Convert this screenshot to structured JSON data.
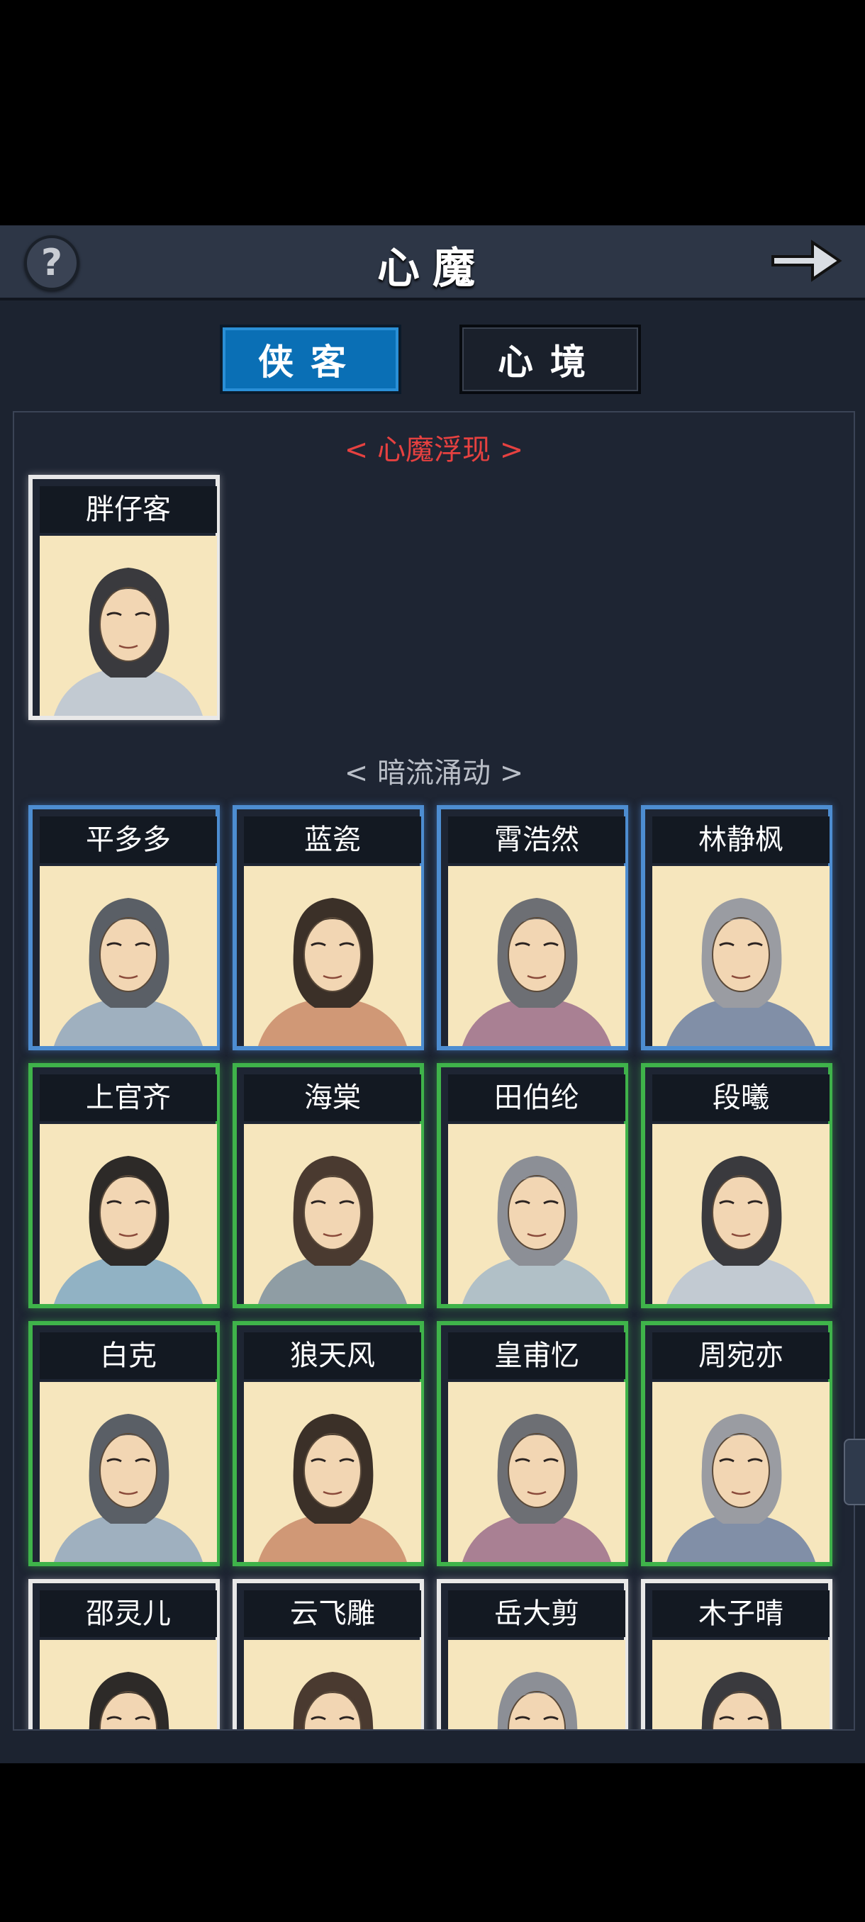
{
  "header": {
    "title": "心魔",
    "help_icon": "question-icon",
    "next_icon": "arrow-right-icon"
  },
  "tabs": [
    {
      "label": "侠客",
      "active": true
    },
    {
      "label": "心境",
      "active": false
    }
  ],
  "sections": [
    {
      "label": "< 心魔浮现 >",
      "color": "#e64140"
    },
    {
      "label": "< 暗流涌动 >",
      "color": "#b9bec7"
    }
  ],
  "featured": [
    {
      "name": "胖仔客",
      "rarity": "white"
    }
  ],
  "characters": [
    {
      "name": "平多多",
      "rarity": "blue"
    },
    {
      "name": "蓝瓷",
      "rarity": "blue"
    },
    {
      "name": "霄浩然",
      "rarity": "blue"
    },
    {
      "name": "林静枫",
      "rarity": "blue"
    },
    {
      "name": "上官齐",
      "rarity": "green"
    },
    {
      "name": "海棠",
      "rarity": "green"
    },
    {
      "name": "田伯纶",
      "rarity": "green"
    },
    {
      "name": "段曦",
      "rarity": "green"
    },
    {
      "name": "白克",
      "rarity": "green"
    },
    {
      "name": "狼天风",
      "rarity": "green"
    },
    {
      "name": "皇甫忆",
      "rarity": "green"
    },
    {
      "name": "周宛亦",
      "rarity": "green"
    },
    {
      "name": "邵灵儿",
      "rarity": "white"
    },
    {
      "name": "云飞雕",
      "rarity": "white"
    },
    {
      "name": "岳大剪",
      "rarity": "white"
    },
    {
      "name": "木子晴",
      "rarity": "white"
    }
  ]
}
